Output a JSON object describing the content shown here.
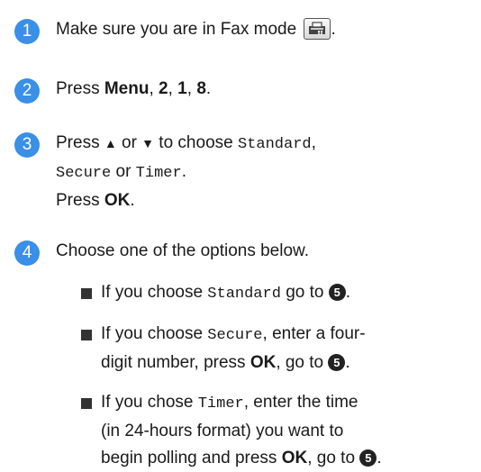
{
  "steps": [
    {
      "number": "1",
      "text_before": "Make sure you are in Fax mode",
      "text_after": ".",
      "icon": "fax-mode-icon"
    },
    {
      "number": "2",
      "parts": [
        "Press ",
        "Menu",
        ", ",
        "2",
        ", ",
        "1",
        ", ",
        "8",
        "."
      ]
    },
    {
      "number": "3",
      "line1": {
        "a": "Press ",
        "up": "▲",
        "b": " or ",
        "down": "▼",
        "c": " to choose ",
        "opt1": "Standard",
        "d": ","
      },
      "line2": {
        "opt2": "Secure",
        "a": " or ",
        "opt3": "Timer",
        "b": "."
      },
      "line3": {
        "a": "Press ",
        "ok": "OK",
        "b": "."
      }
    },
    {
      "number": "4",
      "text": "Choose one of the options below."
    }
  ],
  "options": [
    {
      "a": "If you choose ",
      "mode": "Standard",
      "b": " go to ",
      "ref": "5",
      "c": "."
    },
    {
      "line1": {
        "a": "If you choose ",
        "mode": "Secure",
        "b": ", enter a four-"
      },
      "line2": {
        "a": "digit number, press ",
        "ok": "OK",
        "b": ", go to ",
        "ref": "5",
        "c": "."
      }
    },
    {
      "line1": {
        "a": "If you chose ",
        "mode": "Timer",
        "b": ", enter the time"
      },
      "line2": "(in 24-hours format) you want to",
      "line3": {
        "a": "begin polling and press ",
        "ok": "OK",
        "b": ", go to ",
        "ref": "5",
        "c": "."
      }
    }
  ]
}
